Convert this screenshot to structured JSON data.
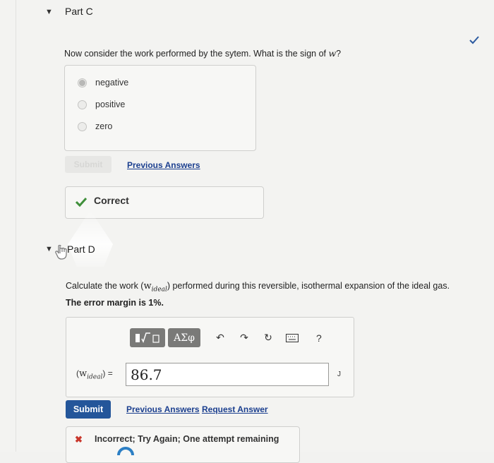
{
  "partC": {
    "title": "Part C",
    "question": "Now consider the work performed by the sytem. What is the sign of ",
    "question_var": "w",
    "question_end": "?",
    "options": [
      "negative",
      "positive",
      "zero"
    ],
    "selected_option": "negative",
    "submit_label": "Submit",
    "previous_answers_label": "Previous Answers",
    "feedback": "Correct",
    "status_icon": "green-check"
  },
  "partD": {
    "title": "Part D",
    "calc_prefix": "Calculate the work (",
    "calc_var": "w",
    "calc_sub": "ideal",
    "calc_suffix": ") performed during this reversible, isothermal expansion of the ideal gas.",
    "margin_text": "The error margin is 1%.",
    "toolbar": {
      "greek_label": "ΑΣφ",
      "help_label": "?"
    },
    "eq_label_open": "(",
    "eq_var": "w",
    "eq_sub": "ideal",
    "eq_label_close": ") =",
    "input_value": "86.7",
    "unit": "J",
    "submit_label": "Submit",
    "previous_answers_label": "Previous Answers",
    "request_answer_label": "Request Answer",
    "feedback_partial": "Incorrect; Try Again; One attempt remaining"
  },
  "colors": {
    "accent": "#24569a",
    "link": "#1b3f8f",
    "correct": "#3f8f3a",
    "incorrect": "#c9372c"
  }
}
